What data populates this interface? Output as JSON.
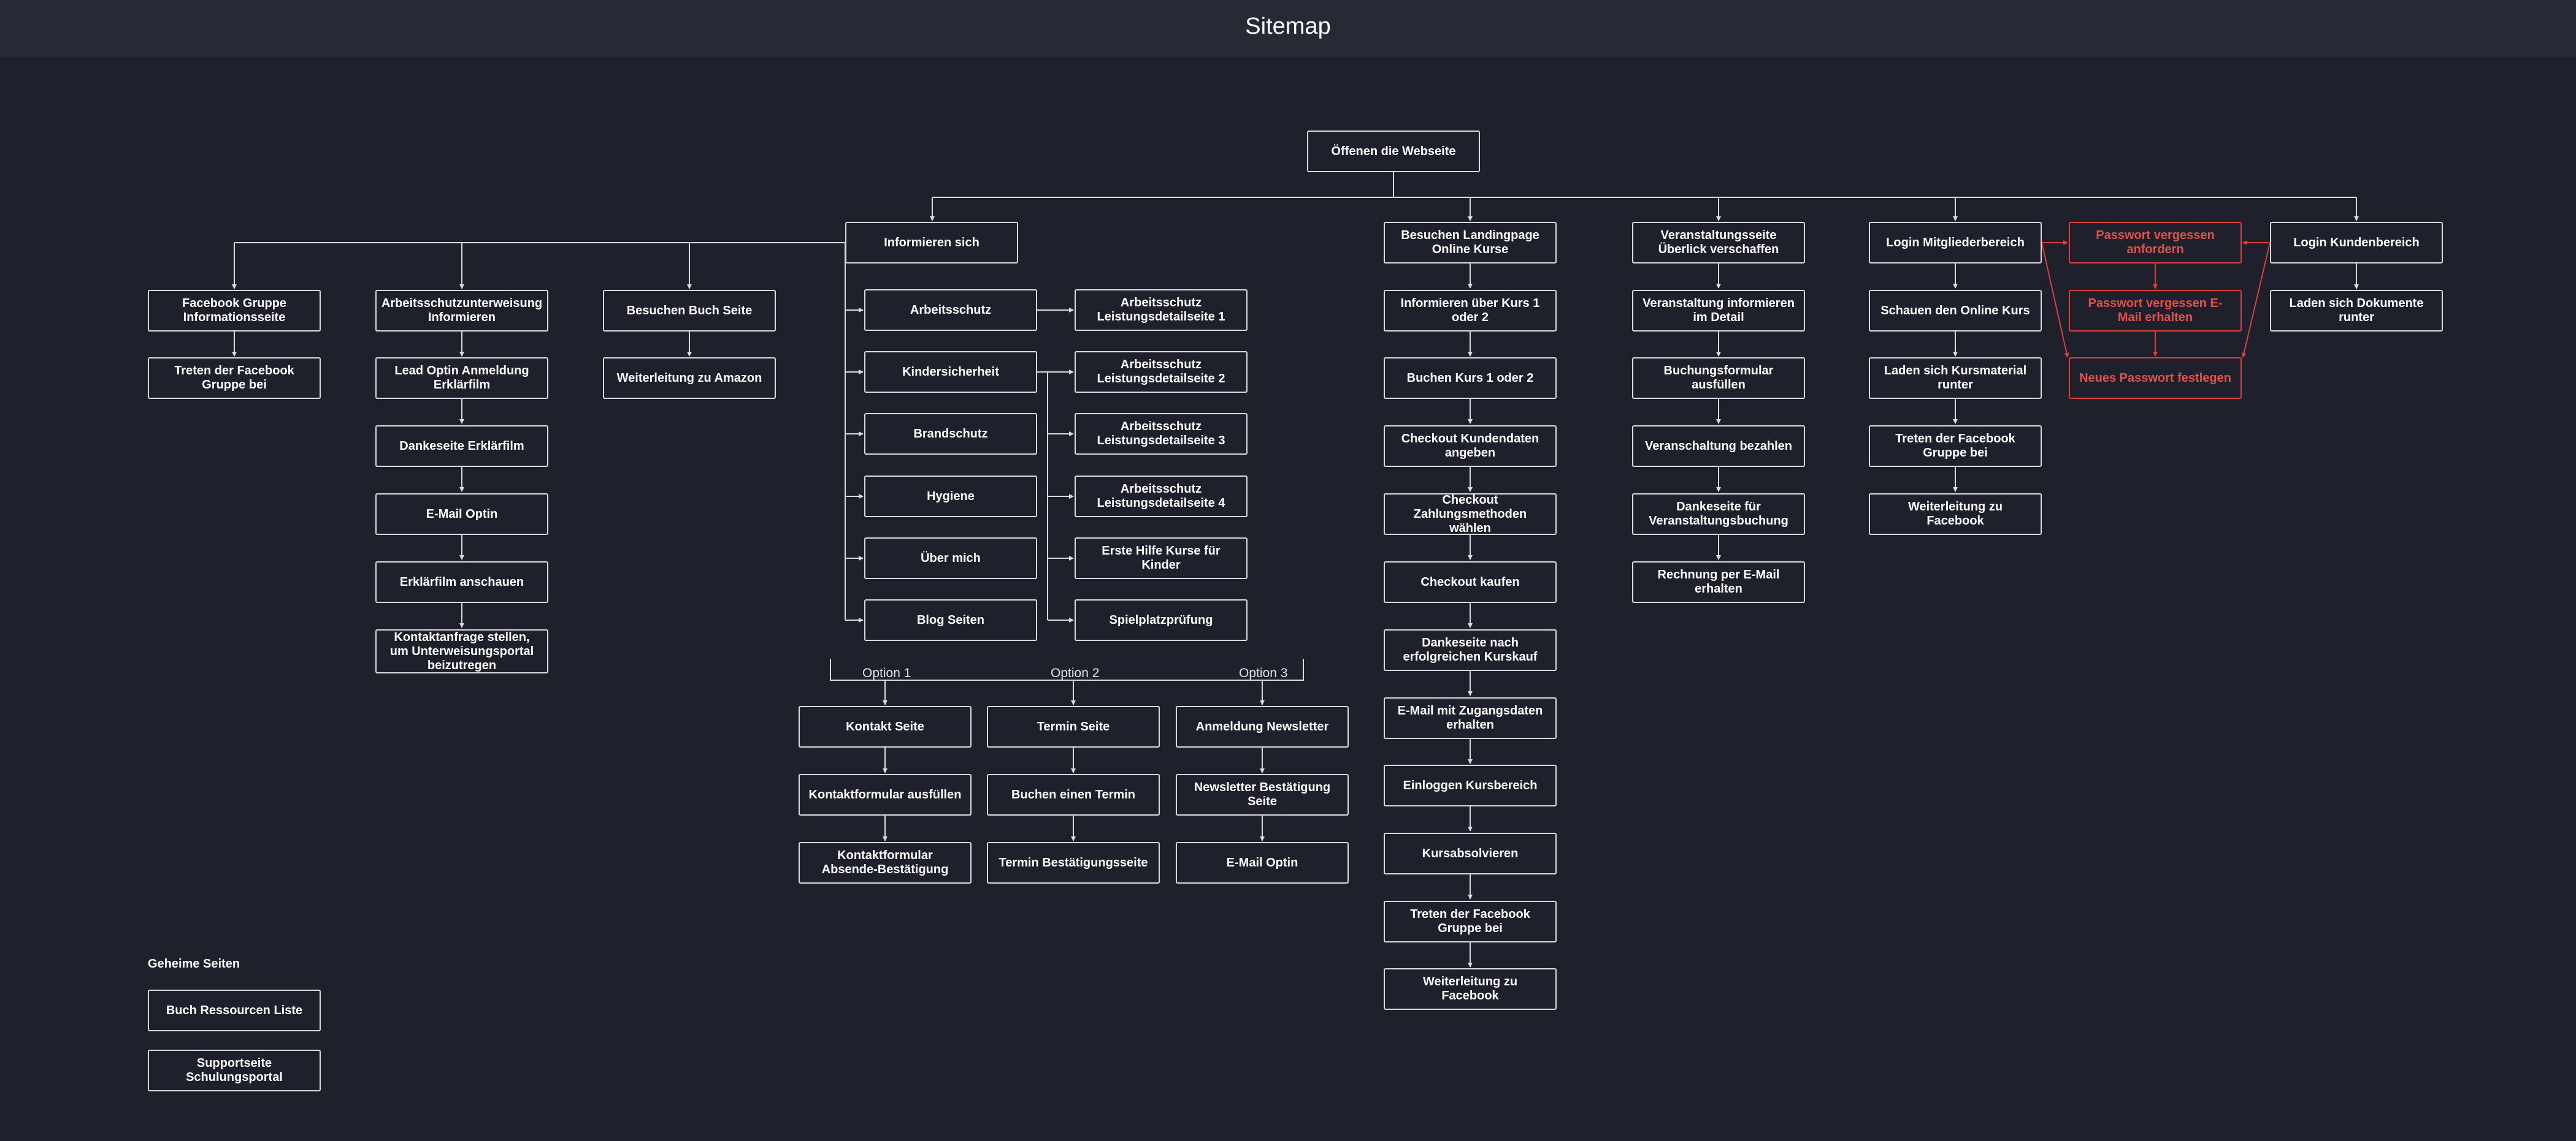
{
  "header": {
    "title": "Sitemap"
  },
  "root": "Öffenen die Webseite",
  "informieren": {
    "hub": "Informieren sich",
    "branches": [
      {
        "items": [
          "Facebook Gruppe Informationsseite",
          "Treten der Facebook Gruppe bei"
        ]
      },
      {
        "items": [
          "Arbeitsschutzunterweisung Informieren",
          "Lead Optin Anmeldung Erklärfilm",
          "Dankeseite Erklärfilm",
          "E-Mail Optin",
          "Erklärfilm anschauen",
          "Kontaktanfrage stellen, um Unterweisungsportal beizutregen"
        ]
      },
      {
        "items": [
          "Besuchen Buch Seite",
          "Weiterleitung zu Amazon"
        ]
      }
    ],
    "topics": [
      "Arbeitsschutz",
      "Kindersicherheit",
      "Brandschutz",
      "Hygiene",
      "Über mich",
      "Blog Seiten"
    ],
    "details": [
      "Arbeitsschutz Leistungsdetailseite 1",
      "Arbeitsschutz Leistungsdetailseite 2",
      "Arbeitsschutz Leistungsdetailseite 3",
      "Arbeitsschutz Leistungsdetailseite 4",
      "Erste Hilfe Kurse für Kinder",
      "Spielplatzprüfung"
    ],
    "options": [
      {
        "label": "Option 1",
        "items": [
          "Kontakt Seite",
          "Kontaktformular ausfüllen",
          "Kontaktformular Absende-Bestätigung"
        ]
      },
      {
        "label": "Option 2",
        "items": [
          "Termin Seite",
          "Buchen einen Termin",
          "Termin Bestätigungsseite"
        ]
      },
      {
        "label": "Option 3",
        "items": [
          "Anmeldung Newsletter",
          "Newsletter Bestätigung Seite",
          "E-Mail Optin"
        ]
      }
    ]
  },
  "landingpage": {
    "items": [
      "Besuchen Landingpage Online Kurse",
      "Informieren über Kurs 1 oder 2",
      "Buchen Kurs 1 oder 2",
      "Checkout Kundendaten angeben",
      "Checkout Zahlungsmethoden wählen",
      "Checkout kaufen",
      "Dankeseite nach erfolgreichen Kurskauf",
      "E-Mail mit Zugangsdaten erhalten",
      "Einloggen Kursbereich",
      "Kursabsolvieren",
      "Treten der Facebook Gruppe bei",
      "Weiterleitung zu Facebook"
    ]
  },
  "veranstaltung": {
    "items": [
      "Veranstaltungsseite Überlick verschaffen",
      "Veranstaltung informieren im Detail",
      "Buchungsformular ausfüllen",
      "Veranschaltung bezahlen",
      "Dankeseite für Veranstaltungsbuchung",
      "Rechnung per E-Mail erhalten"
    ]
  },
  "mitglieder": {
    "items": [
      "Login Mitgliederbereich",
      "Schauen den Online Kurs",
      "Laden sich Kursmaterial runter",
      "Treten der Facebook Gruppe bei",
      "Weiterleitung zu Facebook"
    ]
  },
  "passwort": {
    "items": [
      "Passwort vergessen anfordern",
      "Passwort vergessen E-Mail erhalten",
      "Neues Passwort festlegen"
    ]
  },
  "kunden": {
    "items": [
      "Login Kundenbereich",
      "Laden sich Dokumente runter"
    ]
  },
  "geheime": {
    "title": "Geheime Seiten",
    "items": [
      "Buch Ressourcen Liste",
      "Supportseite Schulungsportal"
    ]
  },
  "colors": {
    "background": "#1e212b",
    "header": "#272a35",
    "border": "#d8dae0",
    "accent_red": "#d9403a"
  }
}
